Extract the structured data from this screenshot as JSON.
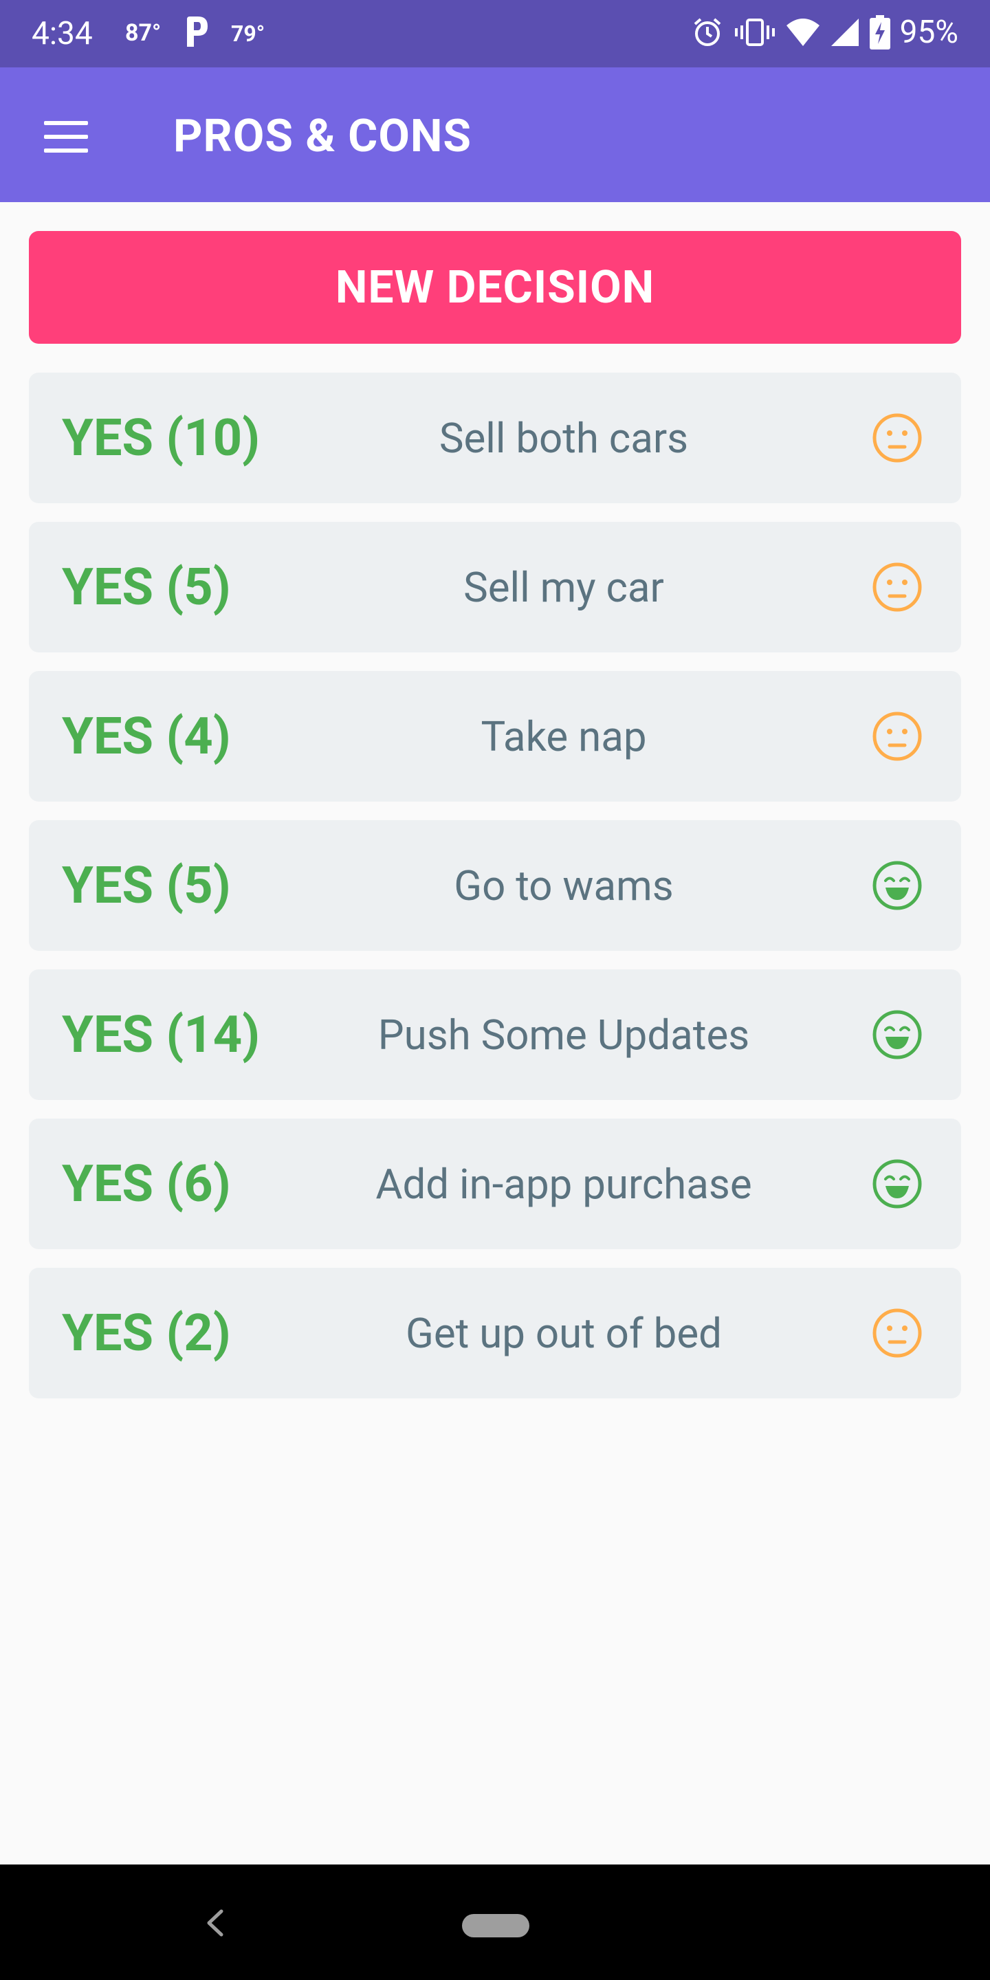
{
  "status_bar": {
    "time": "4:34",
    "temp_1": "87°",
    "temp_2": "79°",
    "battery": "95%"
  },
  "app_bar": {
    "title": "PROS & CONS"
  },
  "new_decision_label": "NEW DECISION",
  "decisions": [
    {
      "verdict": "YES (10)",
      "title": "Sell both cars",
      "mood": "neutral-face-icon"
    },
    {
      "verdict": "YES (5)",
      "title": "Sell my car",
      "mood": "neutral-face-icon"
    },
    {
      "verdict": "YES (4)",
      "title": "Take nap",
      "mood": "neutral-face-icon"
    },
    {
      "verdict": "YES (5)",
      "title": "Go to wams",
      "mood": "happy-face-icon"
    },
    {
      "verdict": "YES (14)",
      "title": "Push Some Updates",
      "mood": "happy-face-icon"
    },
    {
      "verdict": "YES (6)",
      "title": "Add in-app purchase",
      "mood": "happy-face-icon"
    },
    {
      "verdict": "YES (2)",
      "title": "Get up out of bed",
      "mood": "neutral-face-icon"
    }
  ],
  "colors": {
    "status_bar": "#5b4fb1",
    "app_bar": "#7566e3",
    "accent_button": "#ff3f7a",
    "card": "#edf0f2",
    "verdict_green": "#4caf50",
    "neutral_orange": "#ffad4a",
    "happy_green": "#4caf50",
    "title_gray": "#5b7380"
  }
}
